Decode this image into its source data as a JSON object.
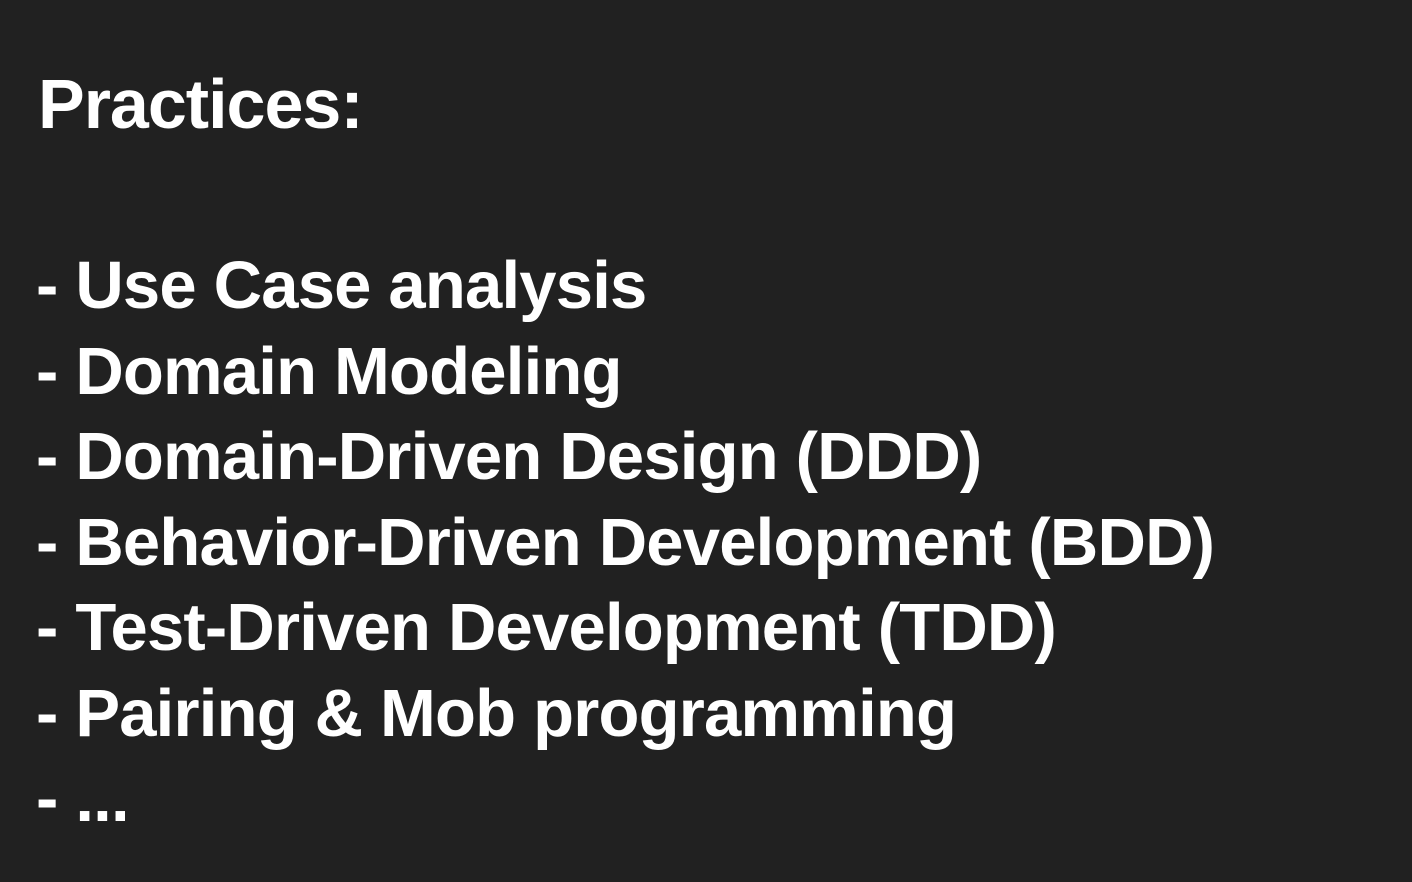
{
  "slide": {
    "title": "Practices:",
    "items": [
      "- Use Case analysis",
      "- Domain Modeling",
      "- Domain-Driven Design (DDD)",
      "- Behavior-Driven Development (BDD)",
      "- Test-Driven Development (TDD)",
      "- Pairing & Mob programming",
      "- ..."
    ]
  },
  "colors": {
    "background": "#212121",
    "text": "#ffffff"
  }
}
